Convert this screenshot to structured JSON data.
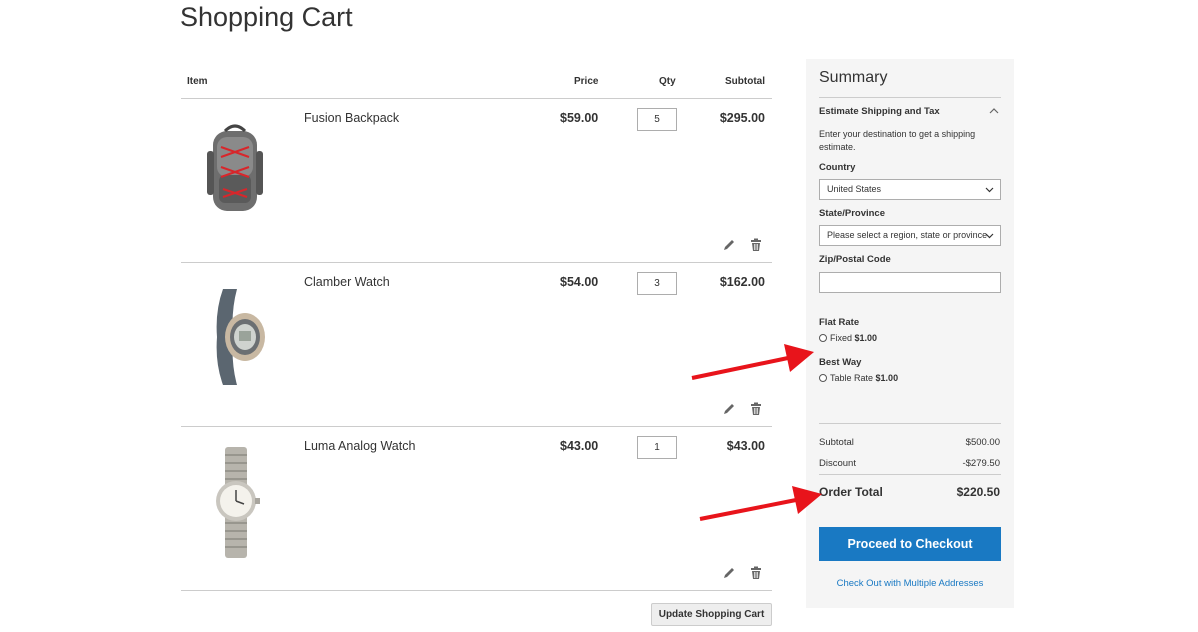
{
  "page": {
    "title": "Shopping Cart"
  },
  "cart": {
    "headers": {
      "item": "Item",
      "price": "Price",
      "qty": "Qty",
      "subtotal": "Subtotal"
    },
    "items": [
      {
        "name": "Fusion Backpack",
        "price": "$59.00",
        "qty": "5",
        "subtotal": "$295.00",
        "image": "backpack-image"
      },
      {
        "name": "Clamber Watch",
        "price": "$54.00",
        "qty": "3",
        "subtotal": "$162.00",
        "image": "sport-watch-image"
      },
      {
        "name": "Luma Analog Watch",
        "price": "$43.00",
        "qty": "1",
        "subtotal": "$43.00",
        "image": "analog-watch-image"
      }
    ],
    "update_label": "Update Shopping Cart"
  },
  "summary": {
    "title": "Summary",
    "estimate": {
      "title": "Estimate Shipping and Tax",
      "note": "Enter your destination to get a shipping estimate.",
      "country_label": "Country",
      "country_value": "United States",
      "state_label": "State/Province",
      "state_value": "Please select a region, state or province.",
      "zip_label": "Zip/Postal Code",
      "zip_value": ""
    },
    "rates": [
      {
        "group": "Flat Rate",
        "option": "Fixed",
        "price": "$1.00"
      },
      {
        "group": "Best Way",
        "option": "Table Rate",
        "price": "$1.00"
      }
    ],
    "totals": {
      "subtotal_label": "Subtotal",
      "subtotal_value": "$500.00",
      "discount_label": "Discount",
      "discount_value": "-$279.50",
      "order_total_label": "Order Total",
      "order_total_value": "$220.50"
    },
    "checkout_label": "Proceed to Checkout",
    "multi_address_label": "Check Out with Multiple Addresses"
  },
  "colors": {
    "accent": "#1979c3",
    "annotation_arrow": "#e8141b",
    "summary_bg": "#f5f5f5"
  }
}
